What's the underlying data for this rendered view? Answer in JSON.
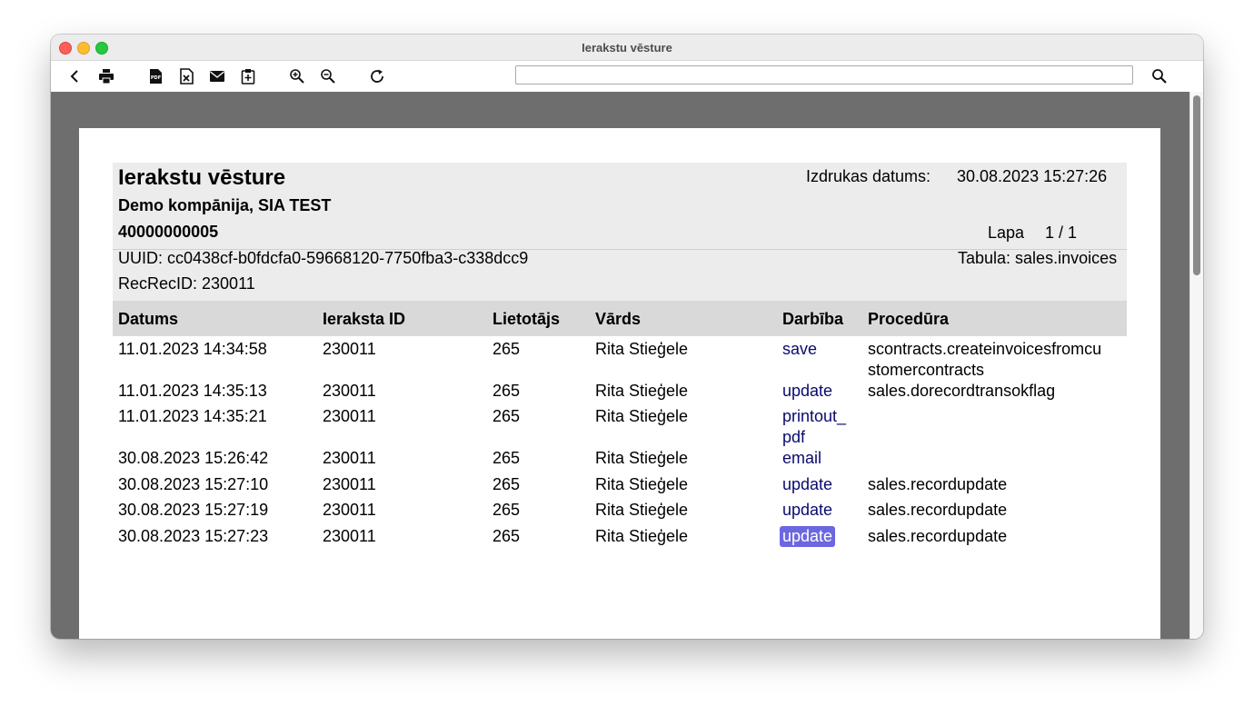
{
  "window": {
    "title": "Ierakstu vēsture"
  },
  "toolbar": {
    "icons": [
      "back-icon",
      "print-icon",
      "pdf-icon",
      "excel-export-icon",
      "email-icon",
      "clipboard-icon",
      "zoom-in-icon",
      "zoom-out-icon",
      "refresh-icon",
      "search-icon"
    ],
    "search_value": ""
  },
  "report": {
    "title": "Ierakstu vēsture",
    "company": "Demo kompānija, SIA TEST",
    "reg_no": "40000000005",
    "print_date_label": "Izdrukas datums:",
    "print_date": "30.08.2023 15:27:26",
    "page_label": "Lapa",
    "page_value": "1 / 1",
    "uuid": "UUID: cc0438cf-b0fdcfa0-59668120-7750fba3-c338dcc9",
    "table_label": "Tabula: sales.invoices",
    "recrec": "RecRecID: 230011"
  },
  "columns": [
    "Datums",
    "Ieraksta ID",
    "Lietotājs",
    "Vārds",
    "Darbība",
    "Procedūra"
  ],
  "rows": [
    {
      "date": "11.01.2023 14:34:58",
      "id": "230011",
      "user": "265",
      "name": "Rita Stieģele",
      "action": "save",
      "procedure": "scontracts.createinvoicesfromcustomercontracts"
    },
    {
      "date": "11.01.2023 14:35:13",
      "id": "230011",
      "user": "265",
      "name": "Rita Stieģele",
      "action": "update",
      "procedure": "sales.dorecordtransokflag"
    },
    {
      "date": "11.01.2023 14:35:21",
      "id": "230011",
      "user": "265",
      "name": "Rita Stieģele",
      "action": "printout_pdf",
      "procedure": ""
    },
    {
      "date": "30.08.2023 15:26:42",
      "id": "230011",
      "user": "265",
      "name": "Rita Stieģele",
      "action": "email",
      "procedure": ""
    },
    {
      "date": "30.08.2023 15:27:10",
      "id": "230011",
      "user": "265",
      "name": "Rita Stieģele",
      "action": "update",
      "procedure": "sales.recordupdate"
    },
    {
      "date": "30.08.2023 15:27:19",
      "id": "230011",
      "user": "265",
      "name": "Rita Stieģele",
      "action": "update",
      "procedure": "sales.recordupdate"
    },
    {
      "date": "30.08.2023 15:27:23",
      "id": "230011",
      "user": "265",
      "name": "Rita Stieģele",
      "action": "update",
      "procedure": "sales.recordupdate",
      "selected": true
    }
  ]
}
